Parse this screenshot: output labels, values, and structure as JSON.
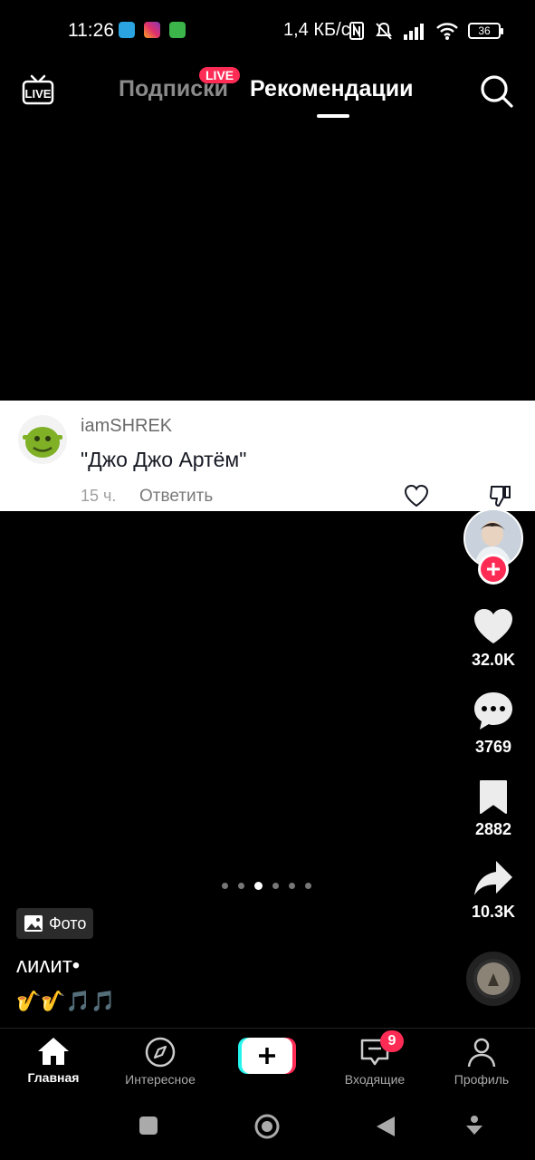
{
  "status_bar": {
    "time": "11:26",
    "network_speed": "1,4 КБ/с",
    "battery": "36"
  },
  "top_nav": {
    "live_icon_text": "LIVE",
    "tab_following": "Подписки",
    "live_badge": "LIVE",
    "tab_for_you": "Рекомендации"
  },
  "comment": {
    "username": "iamSHREK",
    "text": "\"Джо Джо Артём\"",
    "time": "15 ч.",
    "reply": "Ответить"
  },
  "actions": {
    "likes": "32.0K",
    "comments": "3769",
    "saves": "2882",
    "shares": "10.3K"
  },
  "pager": {
    "total": 6,
    "active": 3
  },
  "post": {
    "photo_badge": "Фото",
    "author": "ʌиʌит•",
    "caption": "🎷🎷🎵🎵"
  },
  "bottom_nav": {
    "home": "Главная",
    "discover": "Интересное",
    "inbox": "Входящие",
    "inbox_badge": "9",
    "profile": "Профиль"
  },
  "colors": {
    "accent": "#fe2c55",
    "teal": "#25f4ee"
  }
}
